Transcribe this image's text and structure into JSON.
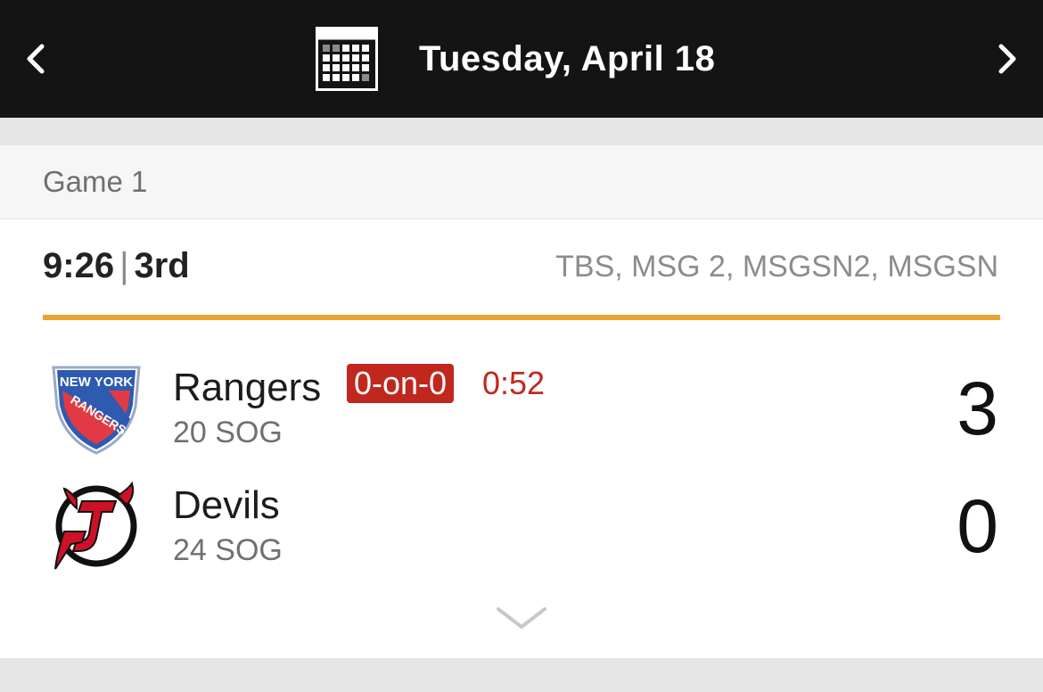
{
  "header": {
    "date": "Tuesday, April 18",
    "prev_icon": "chevron-left-icon",
    "next_icon": "chevron-right-icon",
    "calendar_icon": "calendar-icon",
    "background": "#141414"
  },
  "game": {
    "label": "Game 1",
    "clock": "9:26",
    "separator": "|",
    "period": "3rd",
    "broadcast": "TBS, MSG 2, MSGSN2, MSGSN",
    "progress_color": "#e8a332",
    "teams": [
      {
        "name": "Rangers",
        "sog": "20 SOG",
        "score": "3",
        "logo_text": [
          "NEW YORK",
          "RANGERS"
        ],
        "power_play": {
          "badge": "0-on-0",
          "time": "0:52"
        }
      },
      {
        "name": "Devils",
        "sog": "24 SOG",
        "score": "0"
      }
    ],
    "accent_red": "#c0281e",
    "expand_icon": "chevron-down-icon"
  }
}
